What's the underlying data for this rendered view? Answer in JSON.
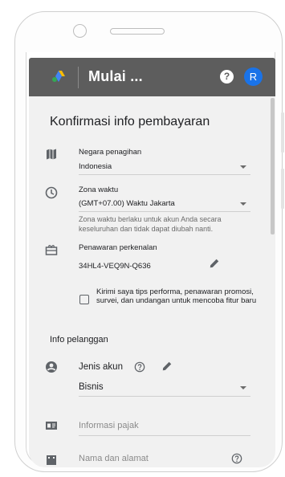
{
  "app": {
    "title": "Mulai ...",
    "help_label": "?",
    "avatar_initial": "R",
    "colors": {
      "appbar": "#5d5d5d",
      "avatar": "#1a73e8",
      "content_bg": "#f1f1f1"
    }
  },
  "form": {
    "title": "Konfirmasi info pembayaran",
    "billing_country": {
      "label": "Negara penagihan",
      "value": "Indonesia",
      "icon": "map-icon"
    },
    "time_zone": {
      "label": "Zona waktu",
      "value": "(GMT+07.00) Waktu Jakarta",
      "note": "Zona waktu berlaku untuk akun Anda secara keseluruhan dan tidak dapat diubah nanti.",
      "icon": "clock-icon"
    },
    "promo": {
      "label": "Penawaran perkenalan",
      "code": "34HL4-VEQ9N-Q636",
      "icon": "gift-icon"
    },
    "opt_in": {
      "checked": false,
      "text": "Kirimi saya tips performa, penawaran promosi, survei, dan undangan untuk mencoba fitur baru"
    }
  },
  "customer": {
    "title": "Info pelanggan",
    "account_type": {
      "label": "Jenis akun",
      "value": "Bisnis",
      "icon": "account-circle-icon"
    },
    "tax_info": {
      "placeholder": "Informasi pajak",
      "icon": "tax-id-card-icon"
    },
    "name_address": {
      "placeholder": "Nama dan alamat",
      "icon": "building-icon"
    }
  }
}
